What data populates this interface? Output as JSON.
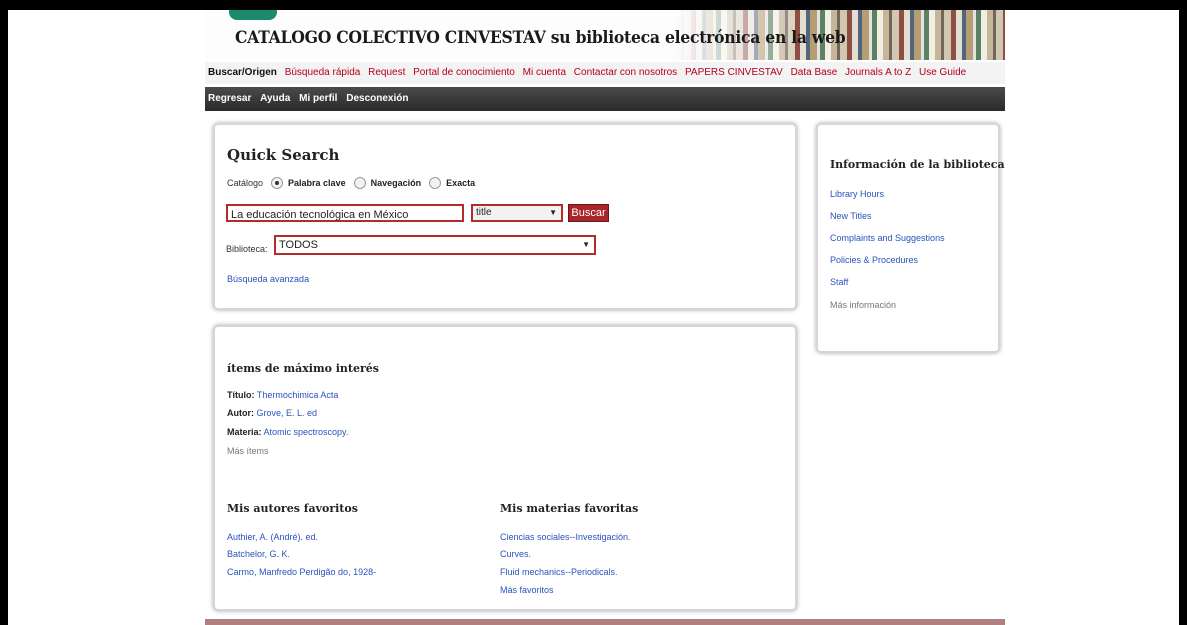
{
  "header": {
    "title": "CATALOGO COLECTIVO CINVESTAV su biblioteca electrónica en la web"
  },
  "topnav": {
    "items": [
      "Buscar/Origen",
      "Búsqueda rápida",
      "Request",
      "Portal de conocimiento",
      "Mi cuenta",
      "Contactar con nosotros",
      "PAPERS CINVESTAV",
      "Data Base",
      "Journals A to Z",
      "Use Guide"
    ]
  },
  "darknav": {
    "items": [
      "Regresar",
      "Ayuda",
      "Mi perfil",
      "Desconexión"
    ]
  },
  "search": {
    "title": "Quick Search",
    "catalog_label": "Catálogo",
    "radios": [
      {
        "label": "Palabra clave",
        "selected": true
      },
      {
        "label": "Navegación",
        "selected": false
      },
      {
        "label": "Exacta",
        "selected": false
      }
    ],
    "query": "La educación tecnológica en México",
    "field_select": "title",
    "button": "Buscar",
    "library_label": "Biblioteca:",
    "library_value": "TODOS",
    "advanced_link": "Búsqueda avanzada"
  },
  "items": {
    "title": "ítems de máximo interés",
    "titulo_label": "Título:",
    "titulo_value": "Thermochimica Acta",
    "autor_label": "Autor:",
    "autor_value": "Grove, E. L. ed",
    "materia_label": "Materia:",
    "materia_value": "Atomic spectroscopy.",
    "more": "Más ítems"
  },
  "favorites": {
    "authors_title": "Mis autores favoritos",
    "authors": [
      "Authier, A. (André). ed.",
      "Batchelor, G. K.",
      "Carmo, Manfredo Perdigão do, 1928-"
    ],
    "subjects_title": "Mis materias favoritas",
    "subjects": [
      "Ciencias sociales--Investigación.",
      "Curves.",
      "Fluid mechanics--Periodicals."
    ],
    "more": "Más favoritos"
  },
  "info": {
    "title": "Información de la biblioteca",
    "links": [
      "Library Hours",
      "New Titles",
      "Complaints and Suggestions",
      "Policies & Procedures",
      "Staff"
    ],
    "more": "Más información"
  },
  "colors": {
    "accent_red": "#b3001b",
    "link_blue": "#2a52be",
    "button_red": "#a8252a"
  }
}
